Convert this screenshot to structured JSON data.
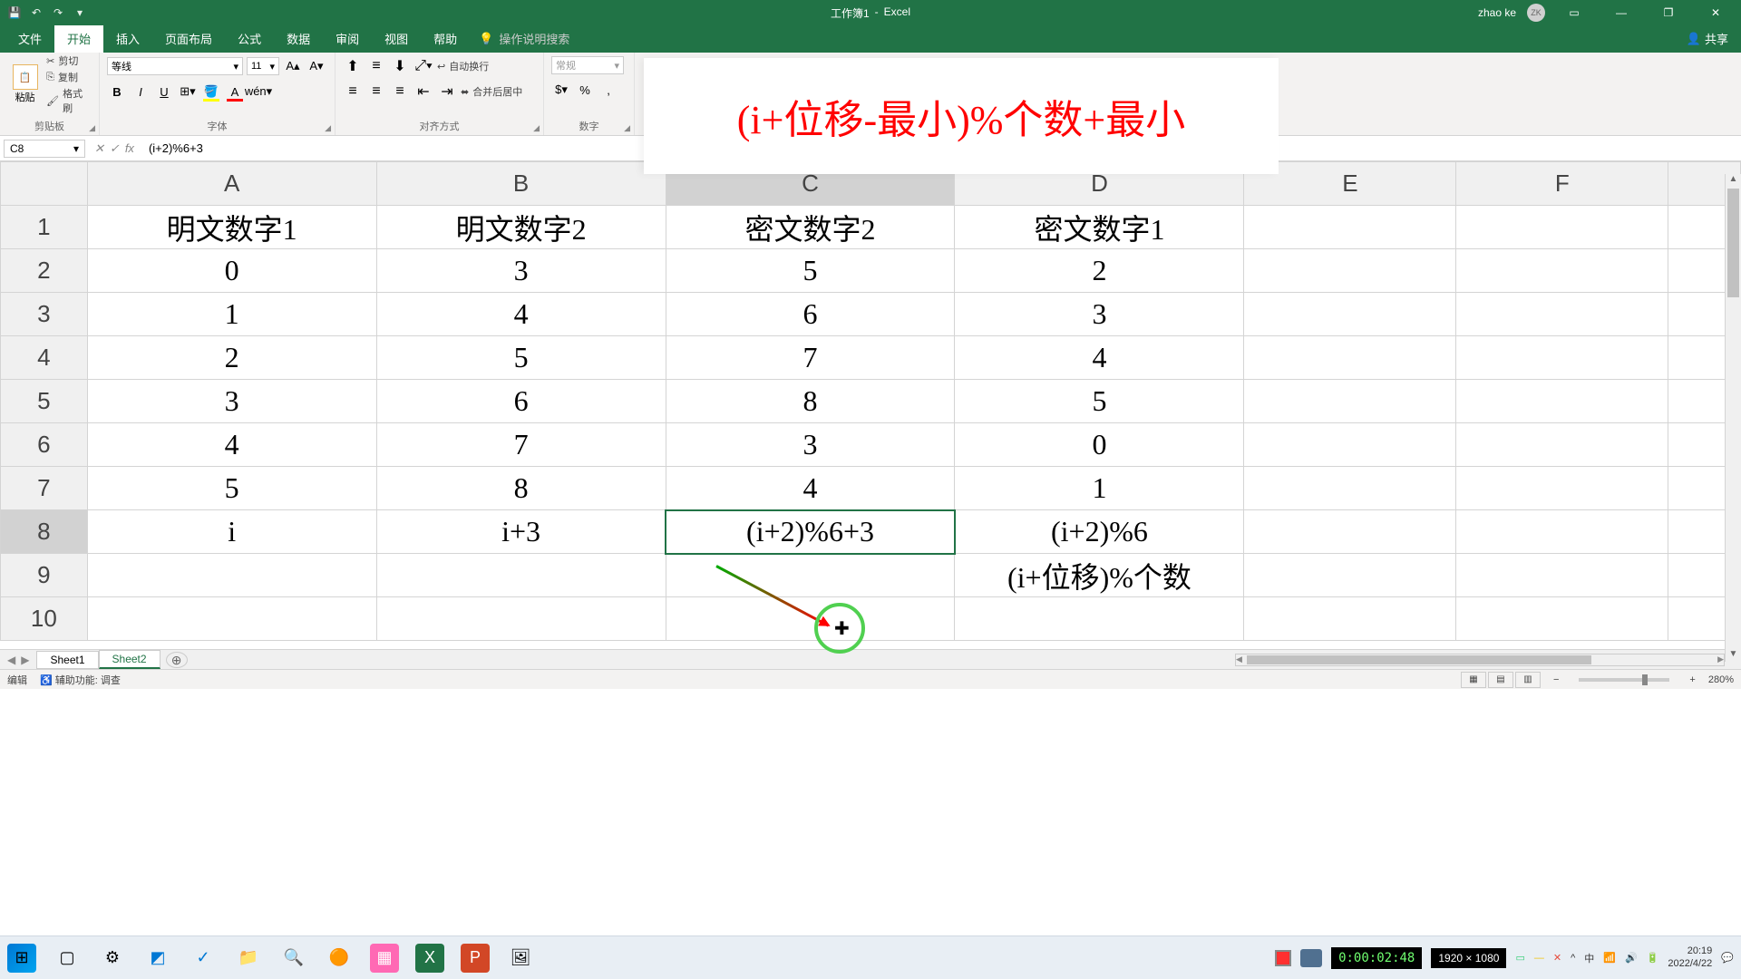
{
  "titlebar": {
    "doc_title": "工作簿1",
    "app_name": "Excel",
    "user_name": "zhao ke",
    "user_initials": "ZK"
  },
  "ribbon_tabs": {
    "file": "文件",
    "home": "开始",
    "insert": "插入",
    "layout": "页面布局",
    "formulas": "公式",
    "data": "数据",
    "review": "审阅",
    "view": "视图",
    "help": "帮助",
    "tell_me": "操作说明搜索",
    "share": "共享"
  },
  "ribbon": {
    "paste": "粘贴",
    "cut": "剪切",
    "copy": "复制",
    "format_painter": "格式刷",
    "clipboard": "剪贴板",
    "font_name": "等线",
    "font_size": "11",
    "font_group": "字体",
    "wrap": "自动换行",
    "merge": "合并后居中",
    "alignment": "对齐方式",
    "num_format": "常规",
    "number": "数字"
  },
  "overlay_formula": "(i+位移-最小)%个数+最小",
  "formula_bar": {
    "name_box": "C8",
    "formula": "(i+2)%6+3"
  },
  "columns": [
    "A",
    "B",
    "C",
    "D",
    "E",
    "F"
  ],
  "rows": [
    "1",
    "2",
    "3",
    "4",
    "5",
    "6",
    "7",
    "8",
    "9",
    "10"
  ],
  "cells": {
    "A1": "明文数字1",
    "B1": "明文数字2",
    "C1": "密文数字2",
    "D1": "密文数字1",
    "A2": "0",
    "B2": "3",
    "C2": "5",
    "D2": "2",
    "A3": "1",
    "B3": "4",
    "C3": "6",
    "D3": "3",
    "A4": "2",
    "B4": "5",
    "C4": "7",
    "D4": "4",
    "A5": "3",
    "B5": "6",
    "C5": "8",
    "D5": "5",
    "A6": "4",
    "B6": "7",
    "C6": "3",
    "D6": "0",
    "A7": "5",
    "B7": "8",
    "C7": "4",
    "D7": "1",
    "A8": "i",
    "B8": "i+3",
    "C8": "(i+2)%6+3",
    "D8": "(i+2)%6",
    "D9": "(i+位移)%个数"
  },
  "selected_cell": "C8",
  "sheets": {
    "sheet1": "Sheet1",
    "sheet2": "Sheet2"
  },
  "status": {
    "mode": "编辑",
    "accessibility": "辅助功能: 调查",
    "zoom": "280%"
  },
  "tray": {
    "dimensions": "1920 × 1080",
    "timer": "0:00:02:48",
    "time": "20:19",
    "date": "2022/4/22"
  }
}
